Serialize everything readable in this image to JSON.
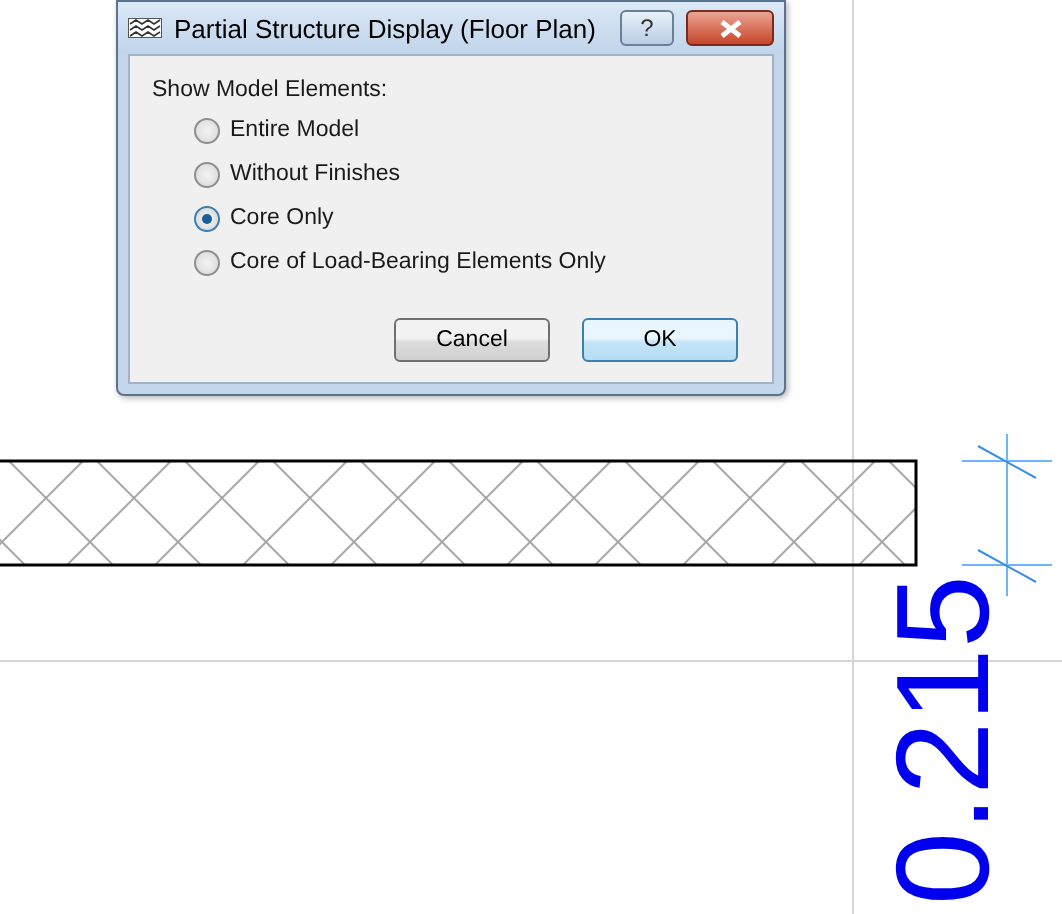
{
  "dialog": {
    "title": "Partial Structure Display (Floor Plan)",
    "help_button": "?",
    "group_label": "Show Model Elements:",
    "options": [
      {
        "label": "Entire Model",
        "selected": false
      },
      {
        "label": "Without Finishes",
        "selected": false
      },
      {
        "label": "Core Only",
        "selected": true
      },
      {
        "label": "Core of Load-Bearing Elements Only",
        "selected": false
      }
    ],
    "buttons": [
      {
        "label": "Cancel",
        "default": false
      },
      {
        "label": "OK",
        "default": true
      }
    ]
  },
  "drawing": {
    "dimension": "0.215"
  }
}
